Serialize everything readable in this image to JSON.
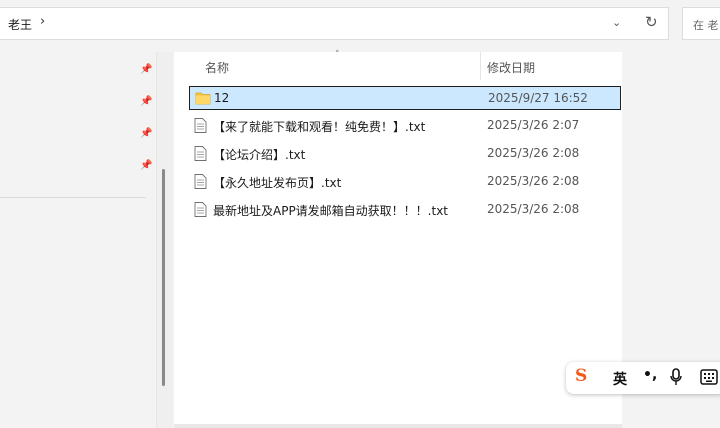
{
  "address_bar": {
    "path": "老王",
    "separator": "›",
    "dropdown_glyph": "⌄",
    "refresh_glyph": "↻"
  },
  "search": {
    "placeholder": "在 老"
  },
  "file_list": {
    "columns": {
      "name": "名称",
      "date": "修改日期"
    },
    "sort_glyph": "˄",
    "rows": [
      {
        "name": "12",
        "date": "2025/9/27 16:52",
        "type": "folder",
        "selected": true
      },
      {
        "name": "【来了就能下载和观看！纯免费！】.txt",
        "date": "2025/3/26 2:07",
        "type": "txt",
        "selected": false
      },
      {
        "name": "【论坛介绍】.txt",
        "date": "2025/3/26 2:08",
        "type": "txt",
        "selected": false
      },
      {
        "name": "【永久地址发布页】.txt",
        "date": "2025/3/26 2:08",
        "type": "txt",
        "selected": false
      },
      {
        "name": "最新地址及APP请发邮箱自动获取！！！.txt",
        "date": "2025/3/26 2:08",
        "type": "txt",
        "selected": false
      }
    ]
  },
  "ime_toolbar": {
    "logo": "S",
    "language": "英",
    "punctuation": "•,",
    "accent_color": "#f25a1a"
  },
  "colors": {
    "selection_bg": "#cce8ff",
    "folder_yellow": "#f5c542"
  }
}
